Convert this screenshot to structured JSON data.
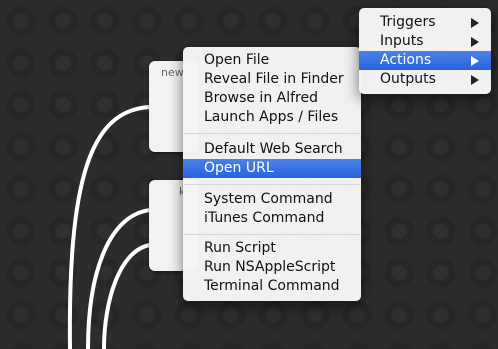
{
  "canvas": {
    "nodes": [
      {
        "label": "new"
      },
      {
        "label": "k"
      }
    ]
  },
  "context_menu": {
    "items": [
      {
        "label": "Open File"
      },
      {
        "label": "Reveal File in Finder"
      },
      {
        "label": "Browse in Alfred"
      },
      {
        "label": "Launch Apps / Files"
      },
      {
        "label": "Default Web Search"
      },
      {
        "label": "Open URL",
        "selected": true
      },
      {
        "label": "System Command"
      },
      {
        "label": "iTunes Command"
      },
      {
        "label": "Run Script"
      },
      {
        "label": "Run NSAppleScript"
      },
      {
        "label": "Terminal Command"
      }
    ]
  },
  "category_menu": {
    "items": [
      {
        "label": "Triggers"
      },
      {
        "label": "Inputs"
      },
      {
        "label": "Actions",
        "selected": true
      },
      {
        "label": "Outputs"
      }
    ]
  },
  "colors": {
    "background": "#2c2c2c",
    "selection": "#3a72e2",
    "wire": "#ffffff"
  }
}
